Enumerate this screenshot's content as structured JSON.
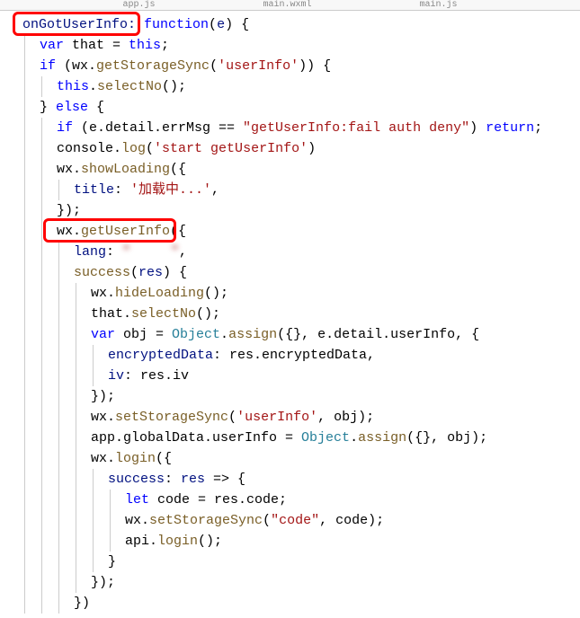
{
  "tabs": {
    "t1": "app.js",
    "t2": "main.wxml",
    "t3": "main.js"
  },
  "code": {
    "l1a": "onGotUserInfo: ",
    "l1b": "function",
    "l1c": "(",
    "l1d": "e",
    "l1e": ") {",
    "l2a": "var",
    "l2b": " that = ",
    "l2c": "this",
    "l2d": ";",
    "l3a": "if",
    "l3b": " (wx.",
    "l3c": "getStorageSync",
    "l3d": "(",
    "l3e": "'userInfo'",
    "l3f": ")) {",
    "l4a": "this",
    "l4b": ".",
    "l4c": "selectNo",
    "l4d": "();",
    "l5a": "} ",
    "l5b": "else",
    "l5c": " {",
    "l6a": "if",
    "l6b": " (e.detail.errMsg == ",
    "l6c": "\"getUserInfo:fail auth deny\"",
    "l6d": ") ",
    "l6e": "return",
    "l6f": ";",
    "l7a": "console.",
    "l7b": "log",
    "l7c": "(",
    "l7d": "'start getUserInfo'",
    "l7e": ")",
    "l8a": "wx.",
    "l8b": "showLoading",
    "l8c": "({",
    "l9a": "title",
    "l9b": ": ",
    "l9c": "'加载中...'",
    "l9d": ",",
    "l10a": "});",
    "l11a": "wx.",
    "l11b": "getUserInfo",
    "l11c": "({",
    "l12a": "lang",
    "l12b": ": ",
    "l12c": "\"     \"",
    "l12d": ",",
    "l13a": "success",
    "l13b": "(",
    "l13c": "res",
    "l13d": ") {",
    "l14a": "wx.",
    "l14b": "hideLoading",
    "l14c": "();",
    "l15a": "that.",
    "l15b": "selectNo",
    "l15c": "();",
    "l16a": "var",
    "l16b": " obj = ",
    "l16c": "Object",
    "l16d": ".",
    "l16e": "assign",
    "l16f": "({}, e.detail.userInfo, {",
    "l17a": "encryptedData",
    "l17b": ": res.encryptedData,",
    "l18a": "iv",
    "l18b": ": res.iv",
    "l19a": "});",
    "l20a": "wx.",
    "l20b": "setStorageSync",
    "l20c": "(",
    "l20d": "'userInfo'",
    "l20e": ", obj);",
    "l21a": "app.globalData.userInfo = ",
    "l21b": "Object",
    "l21c": ".",
    "l21d": "assign",
    "l21e": "({}, obj);",
    "l22a": "wx.",
    "l22b": "login",
    "l22c": "({",
    "l23a": "success",
    "l23b": ": ",
    "l23c": "res",
    "l23d": " => {",
    "l24a": "let",
    "l24b": " code = res.code;",
    "l25a": "wx.",
    "l25b": "setStorageSync",
    "l25c": "(",
    "l25d": "\"code\"",
    "l25e": ", code);",
    "l26a": "api.",
    "l26b": "login",
    "l26c": "();",
    "l27a": "}",
    "l28a": "});",
    "l29a": "})"
  }
}
